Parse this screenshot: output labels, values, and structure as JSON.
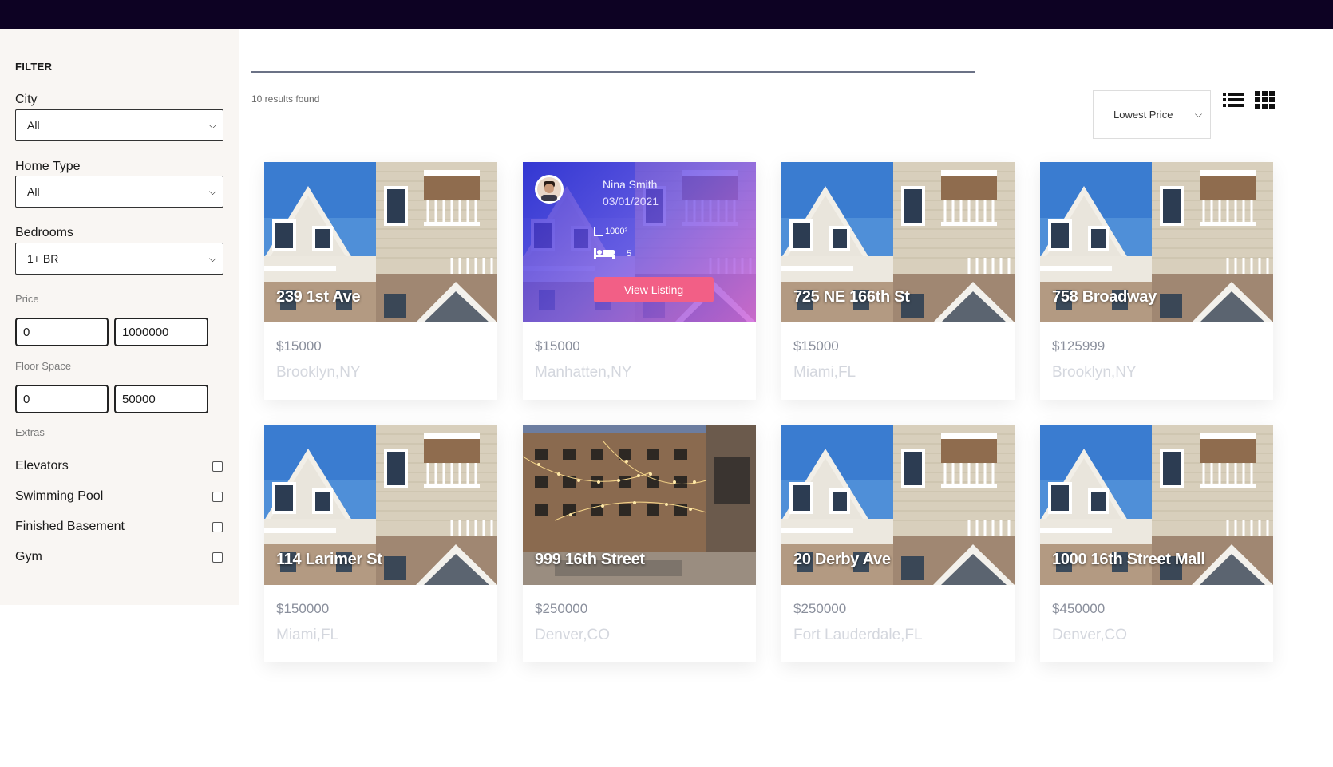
{
  "filter": {
    "title": "FILTER",
    "city_label": "City",
    "city_value": "All",
    "home_type_label": "Home Type",
    "home_type_value": "All",
    "bedrooms_label": "Bedrooms",
    "bedrooms_value": "1+ BR",
    "price_label": "Price",
    "price_min": "0",
    "price_max": "1000000",
    "floor_label": "Floor Space",
    "floor_min": "0",
    "floor_max": "50000",
    "extras_label": "Extras",
    "extras": [
      {
        "label": "Elevators",
        "checked": false
      },
      {
        "label": "Swimming Pool",
        "checked": false
      },
      {
        "label": "Finished Basement",
        "checked": false
      },
      {
        "label": "Gym",
        "checked": false
      }
    ]
  },
  "results": {
    "count_text": "10 results found",
    "sort_value": "Lowest Price"
  },
  "listings": [
    {
      "address": "239 1st Ave",
      "price": "$15000",
      "location": "Brooklyn,NY",
      "image": "apartment-building"
    },
    {
      "address": "",
      "price": "$15000",
      "location": "Manhatten,NY",
      "image": "apartment-building",
      "hover": {
        "agent_name": "Nina Smith",
        "date": "03/01/2021",
        "area": "1000²",
        "bedrooms": "5",
        "button": "View Listing"
      }
    },
    {
      "address": "725 NE 166th St",
      "price": "$15000",
      "location": "Miami,FL",
      "image": "apartment-building"
    },
    {
      "address": "758 Broadway",
      "price": "$125999",
      "location": "Brooklyn,NY",
      "image": "apartment-building"
    },
    {
      "address": "114 Larimer St",
      "price": "$150000",
      "location": "Miami,FL",
      "image": "apartment-building"
    },
    {
      "address": "999 16th Street",
      "price": "$250000",
      "location": "Denver,CO",
      "image": "courtyard-lights"
    },
    {
      "address": "20 Derby Ave",
      "price": "$250000",
      "location": "Fort Lauderdale,FL",
      "image": "apartment-building"
    },
    {
      "address": "1000 16th Street Mall",
      "price": "$450000",
      "location": "Denver,CO",
      "image": "apartment-building"
    }
  ],
  "colors": {
    "topbar": "#0d0223",
    "sidebar_bg": "#f9f6f3",
    "button_pink": "#f25f86",
    "overlay_start": "#3028d2",
    "overlay_end": "#d264dc"
  }
}
